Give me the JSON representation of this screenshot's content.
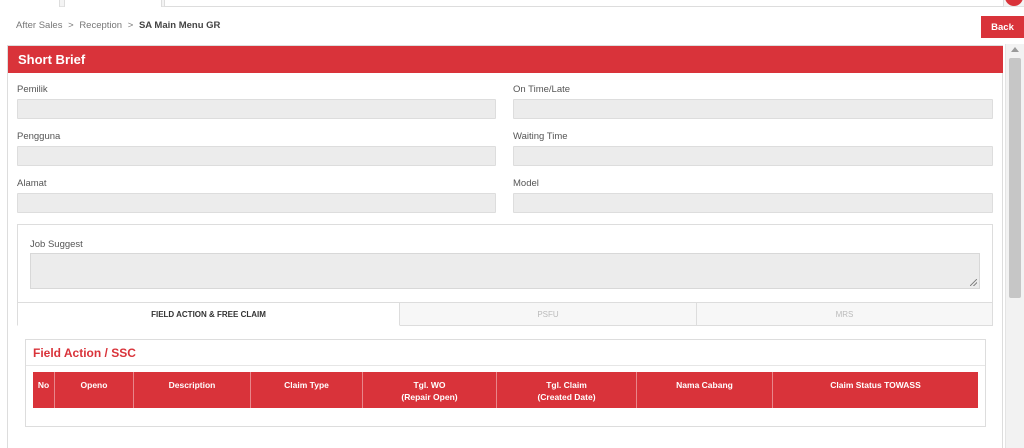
{
  "breadcrumb": {
    "items": [
      "After Sales",
      "Reception"
    ],
    "current": "SA Main Menu GR",
    "separator": ">"
  },
  "header": {
    "back_label": "Back"
  },
  "short_brief": {
    "title": "Short Brief",
    "fields": {
      "pemilik": {
        "label": "Pemilik",
        "value": ""
      },
      "on_time_late": {
        "label": "On Time/Late",
        "value": ""
      },
      "pengguna": {
        "label": "Pengguna",
        "value": ""
      },
      "waiting_time": {
        "label": "Waiting Time",
        "value": ""
      },
      "alamat": {
        "label": "Alamat",
        "value": ""
      },
      "model": {
        "label": "Model",
        "value": ""
      }
    },
    "job_suggest": {
      "label": "Job Suggest",
      "value": ""
    }
  },
  "tabs": [
    {
      "label": "FIELD ACTION & FREE CLAIM",
      "active": true
    },
    {
      "label": "PSFU",
      "active": false
    },
    {
      "label": "MRS",
      "active": false
    }
  ],
  "field_action": {
    "title": "Field Action / SSC",
    "columns": [
      {
        "line1": "No",
        "line2": ""
      },
      {
        "line1": "Openo",
        "line2": ""
      },
      {
        "line1": "Description",
        "line2": ""
      },
      {
        "line1": "Claim Type",
        "line2": ""
      },
      {
        "line1": "Tgl. WO",
        "line2": "(Repair Open)"
      },
      {
        "line1": "Tgl. Claim",
        "line2": "(Created Date)"
      },
      {
        "line1": "Nama Cabang",
        "line2": ""
      },
      {
        "line1": "Claim Status TOWASS",
        "line2": ""
      }
    ],
    "rows": []
  },
  "colors": {
    "accent": "#d9333a",
    "field_bg": "#ececec",
    "page_bg": "#ffffff"
  }
}
